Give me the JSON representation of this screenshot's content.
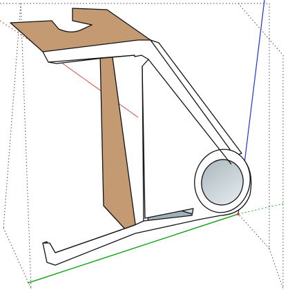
{
  "viewport": {
    "background": "#ffffff",
    "axes": {
      "red": "#c84a3a",
      "green": "#1ea51e",
      "blue": "#1f2fd8"
    },
    "bounding_box_line_color": "#444444",
    "model": {
      "face_color": "#c49a72",
      "edge_color": "#111111",
      "inner_face_color": "#ffffff",
      "shade_dark": "#6e7e86",
      "shade_mid": "#9fb0b8",
      "shade_light": "#d8e2e6"
    }
  }
}
